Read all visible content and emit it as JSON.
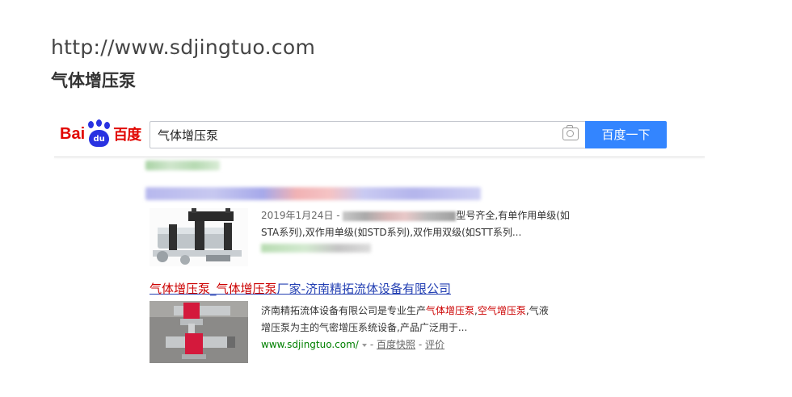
{
  "caption": {
    "url": "http://www.sdjingtuo.com",
    "keyword": "气体增压泵"
  },
  "logo": {
    "part1": "Bai",
    "paw_text": "du",
    "part2": "百度"
  },
  "search": {
    "query": "气体增压泵",
    "button_label": "百度一下",
    "camera_icon": "camera-icon"
  },
  "result1": {
    "date": "2019年1月24日 -",
    "snippet_a": "型号齐全,有单作用单级(如",
    "snippet_b": "STA系列),双作用单级(如STD系列),双作用双级(如STT系列..."
  },
  "result2": {
    "title_hl1": "气体增压泵",
    "title_sep1": "_",
    "title_hl2": "气体增压泵",
    "title_rest": "厂家-济南精拓流体设备有限公司",
    "snip_1": "济南精拓流体设备有限公司是专业生产",
    "snip_hl1": "气体增压泵",
    "snip_2": ",",
    "snip_hl2": "空气增压泵",
    "snip_3": ",气液",
    "snip_4": "增压泵为主的气密增压系统设备,产品广泛用于...",
    "url": "www.sdjingtuo.com/",
    "sep1": "-",
    "snapshot": "百度快照",
    "sep2": "-",
    "review": "评价"
  },
  "colors": {
    "brand_red": "#e10601",
    "brand_blue": "#2932e1",
    "button_blue": "#3385ff",
    "link_blue": "#2440b3",
    "highlight_red": "#cc0000",
    "url_green": "#008000"
  }
}
